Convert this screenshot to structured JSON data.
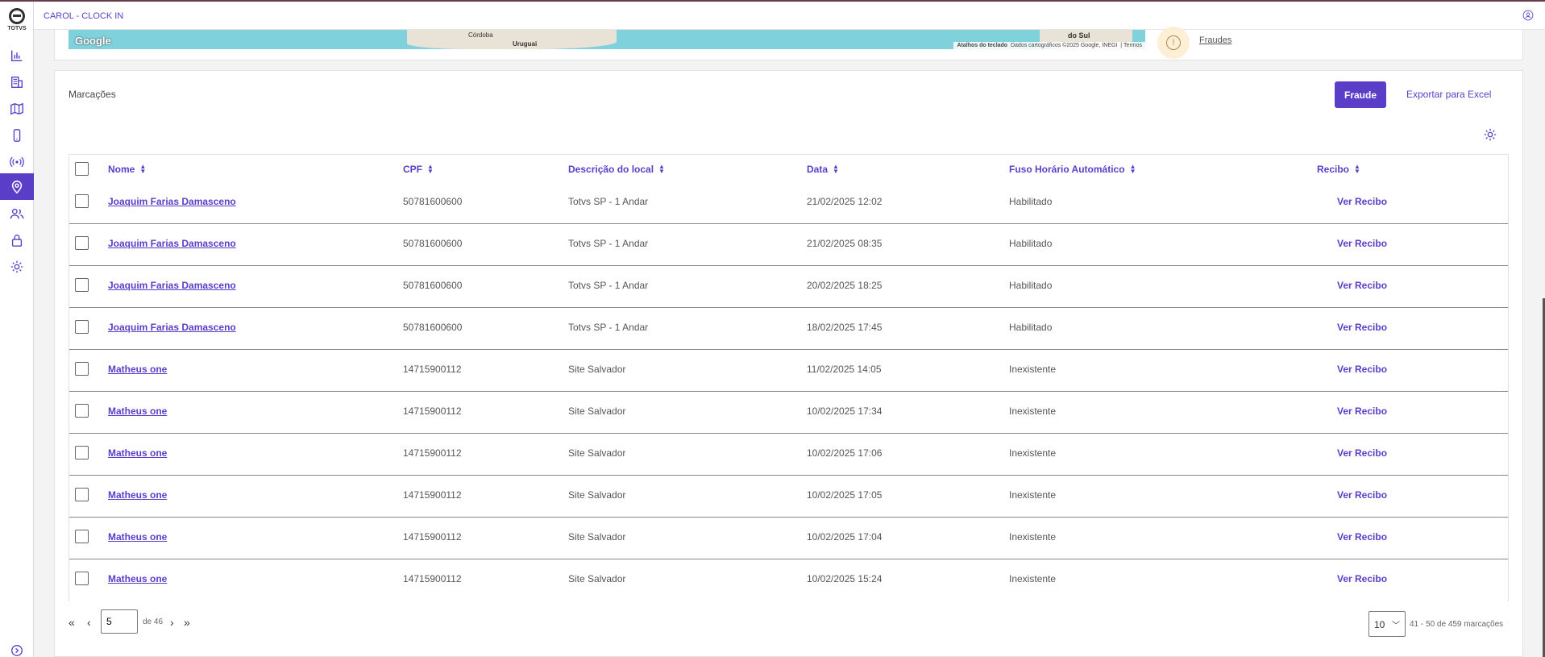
{
  "app": {
    "title": "CAROL - CLOCK IN",
    "logo_text": "TOTVS"
  },
  "sidebar": {
    "items": [
      {
        "icon": "chart-icon",
        "active": false
      },
      {
        "icon": "building-icon",
        "active": false
      },
      {
        "icon": "map-icon",
        "active": false
      },
      {
        "icon": "phone-icon",
        "active": false
      },
      {
        "icon": "signal-icon",
        "active": false
      },
      {
        "icon": "location-pin-icon",
        "active": true
      },
      {
        "icon": "users-icon",
        "active": false
      },
      {
        "icon": "lock-icon",
        "active": false
      },
      {
        "icon": "gear-icon",
        "active": false
      }
    ]
  },
  "map": {
    "city_1": "Córdoba",
    "city_2": "Uruguai",
    "city_3": "do Sul",
    "logo": "Google",
    "attrib_shortcuts": "Atalhos do teclado",
    "attrib_data": "Dados cartográficos ©2025 Google, INEGI",
    "attrib_terms": "Termos",
    "fraud_link": "Fraudes"
  },
  "marcacoes": {
    "title": "Marcações",
    "fraude_button": "Fraude",
    "export_button": "Exportar para Excel",
    "columns": [
      "Nome",
      "CPF",
      "Descrição do local",
      "Data",
      "Fuso Horário Automático",
      "Recibo"
    ],
    "rows": [
      {
        "nome": "Joaquim Farias Damasceno",
        "cpf": "50781600600",
        "local": "Totvs SP - 1 Andar",
        "data": "21/02/2025 12:02",
        "fuso": "Habilitado",
        "recibo": "Ver Recibo"
      },
      {
        "nome": "Joaquim Farias Damasceno",
        "cpf": "50781600600",
        "local": "Totvs SP - 1 Andar",
        "data": "21/02/2025 08:35",
        "fuso": "Habilitado",
        "recibo": "Ver Recibo"
      },
      {
        "nome": "Joaquim Farias Damasceno",
        "cpf": "50781600600",
        "local": "Totvs SP - 1 Andar",
        "data": "20/02/2025 18:25",
        "fuso": "Habilitado",
        "recibo": "Ver Recibo"
      },
      {
        "nome": "Joaquim Farias Damasceno",
        "cpf": "50781600600",
        "local": "Totvs SP - 1 Andar",
        "data": "18/02/2025 17:45",
        "fuso": "Habilitado",
        "recibo": "Ver Recibo"
      },
      {
        "nome": "Matheus one",
        "cpf": "14715900112",
        "local": "Site Salvador",
        "data": "11/02/2025 14:05",
        "fuso": "Inexistente",
        "recibo": "Ver Recibo"
      },
      {
        "nome": "Matheus one",
        "cpf": "14715900112",
        "local": "Site Salvador",
        "data": "10/02/2025 17:34",
        "fuso": "Inexistente",
        "recibo": "Ver Recibo"
      },
      {
        "nome": "Matheus one",
        "cpf": "14715900112",
        "local": "Site Salvador",
        "data": "10/02/2025 17:06",
        "fuso": "Inexistente",
        "recibo": "Ver Recibo"
      },
      {
        "nome": "Matheus one",
        "cpf": "14715900112",
        "local": "Site Salvador",
        "data": "10/02/2025 17:05",
        "fuso": "Inexistente",
        "recibo": "Ver Recibo"
      },
      {
        "nome": "Matheus one",
        "cpf": "14715900112",
        "local": "Site Salvador",
        "data": "10/02/2025 17:04",
        "fuso": "Inexistente",
        "recibo": "Ver Recibo"
      },
      {
        "nome": "Matheus one",
        "cpf": "14715900112",
        "local": "Site Salvador",
        "data": "10/02/2025 15:24",
        "fuso": "Inexistente",
        "recibo": "Ver Recibo"
      }
    ]
  },
  "pagination": {
    "current_page": "5",
    "of_total": "de 46",
    "per_page": "10",
    "range": "41 - 50 de 459 marcações"
  },
  "colors": {
    "accent": "#5b3ec8"
  }
}
